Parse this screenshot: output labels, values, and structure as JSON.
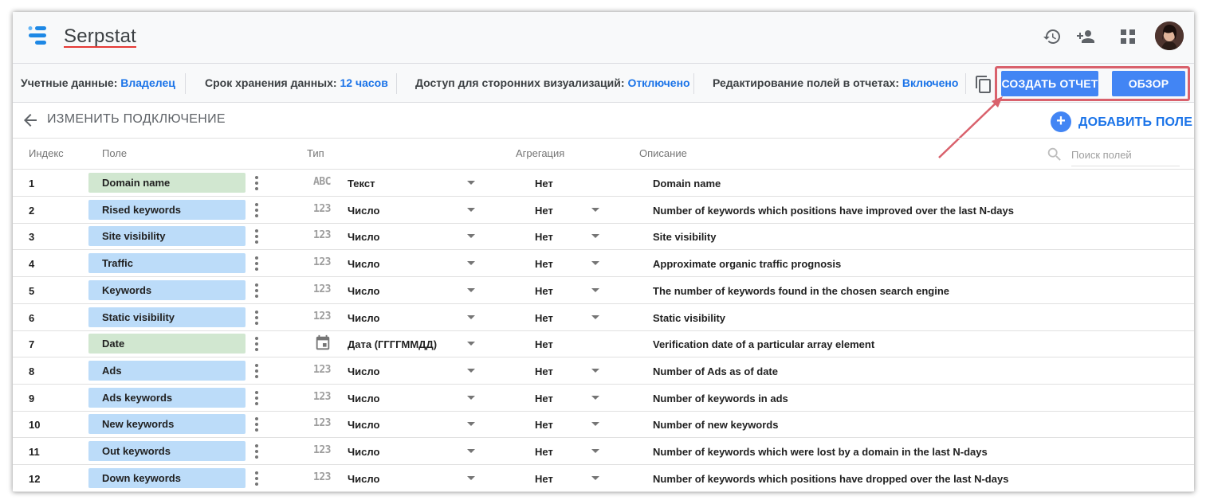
{
  "app": {
    "name": "Serpstat"
  },
  "header_icons": [
    "history-icon",
    "add-person-icon",
    "apps-grid-icon"
  ],
  "info_bar": {
    "items": [
      {
        "label": "Учетные данные:",
        "value": "Владелец"
      },
      {
        "label": "Срок хранения данных:",
        "value": "12 часов"
      },
      {
        "label": "Доступ для сторонних визуализаций:",
        "value": "Отключено"
      },
      {
        "label": "Редактирование полей в отчетах:",
        "value": "Включено"
      }
    ],
    "create_report_label": "СОЗДАТЬ ОТЧЕТ",
    "overview_label": "ОБЗОР"
  },
  "subheader": {
    "back_label": "ИЗМЕНИТЬ ПОДКЛЮЧЕНИЕ",
    "add_field_label": "ДОБАВИТЬ ПОЛЕ"
  },
  "table": {
    "columns": {
      "index": "Индекс",
      "field": "Поле",
      "type": "Тип",
      "aggregation": "Агрегация",
      "description": "Описание"
    },
    "search_placeholder": "Поиск полей",
    "colors": {
      "metric": "#bcdcf9",
      "dimension": "#d1e7d0",
      "accent": "#4285f4"
    },
    "rows": [
      {
        "index": "1",
        "field": "Domain name",
        "kind": "dimension",
        "type_icon": "ABC",
        "type": "Текст",
        "aggregation": "Нет",
        "agg_caret": false,
        "description": "Domain name"
      },
      {
        "index": "2",
        "field": "Rised keywords",
        "kind": "metric",
        "type_icon": "123",
        "type": "Число",
        "aggregation": "Нет",
        "agg_caret": true,
        "description": "Number of keywords which positions have improved over the last N-days"
      },
      {
        "index": "3",
        "field": "Site visibility",
        "kind": "metric",
        "type_icon": "123",
        "type": "Число",
        "aggregation": "Нет",
        "agg_caret": true,
        "description": "Site visibility"
      },
      {
        "index": "4",
        "field": "Traffic",
        "kind": "metric",
        "type_icon": "123",
        "type": "Число",
        "aggregation": "Нет",
        "agg_caret": true,
        "description": "Approximate organic traffic prognosis"
      },
      {
        "index": "5",
        "field": "Keywords",
        "kind": "metric",
        "type_icon": "123",
        "type": "Число",
        "aggregation": "Нет",
        "agg_caret": true,
        "description": "The number of keywords found in the chosen search engine"
      },
      {
        "index": "6",
        "field": "Static visibility",
        "kind": "metric",
        "type_icon": "123",
        "type": "Число",
        "aggregation": "Нет",
        "agg_caret": true,
        "description": "Static visibility"
      },
      {
        "index": "7",
        "field": "Date",
        "kind": "dimension",
        "type_icon": "calendar",
        "type": "Дата (ГГГГММДД)",
        "aggregation": "Нет",
        "agg_caret": false,
        "description": "Verification date of a particular array element"
      },
      {
        "index": "8",
        "field": "Ads",
        "kind": "metric",
        "type_icon": "123",
        "type": "Число",
        "aggregation": "Нет",
        "agg_caret": true,
        "description": "Number of Ads as of date"
      },
      {
        "index": "9",
        "field": "Ads keywords",
        "kind": "metric",
        "type_icon": "123",
        "type": "Число",
        "aggregation": "Нет",
        "agg_caret": true,
        "description": "Number of keywords in ads"
      },
      {
        "index": "10",
        "field": "New keywords",
        "kind": "metric",
        "type_icon": "123",
        "type": "Число",
        "aggregation": "Нет",
        "agg_caret": true,
        "description": "Number of new keywords"
      },
      {
        "index": "11",
        "field": "Out keywords",
        "kind": "metric",
        "type_icon": "123",
        "type": "Число",
        "aggregation": "Нет",
        "agg_caret": true,
        "description": "Number of keywords which were lost by a domain in the last N-days"
      },
      {
        "index": "12",
        "field": "Down keywords",
        "kind": "metric",
        "type_icon": "123",
        "type": "Число",
        "aggregation": "Нет",
        "agg_caret": true,
        "description": "Number of keywords which positions have dropped over the last N-days"
      }
    ]
  }
}
